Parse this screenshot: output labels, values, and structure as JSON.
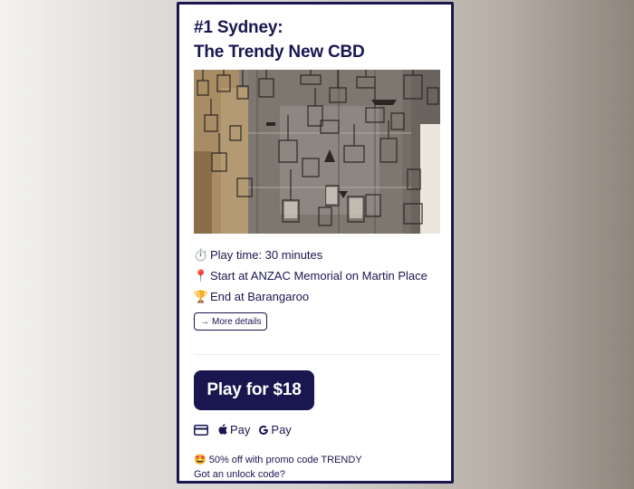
{
  "tour": {
    "title_line1": "#1 Sydney:",
    "title_line2": "The Trendy New CBD",
    "photo_icon": "hanging-birdcages-image"
  },
  "details": [
    {
      "icon": "stopwatch-icon",
      "emoji": "⏱️",
      "text": "Play time: 30 minutes"
    },
    {
      "icon": "pin-icon",
      "emoji": "📍",
      "text": "Start at ANZAC Memorial on Martin Place"
    },
    {
      "icon": "trophy-icon",
      "emoji": "🏆",
      "text": "End at Barangaroo"
    }
  ],
  "more_details": {
    "arrow": "→",
    "label": "More details"
  },
  "play": {
    "label": "Play for $18"
  },
  "payments": {
    "apple_pay": "Pay",
    "google_pay": "Pay"
  },
  "promo": {
    "emoji": "🤩",
    "text": "50% off with promo code TRENDY",
    "unlock": "Got an unlock code?"
  },
  "colors": {
    "navy": "#1a1650",
    "white": "#ffffff"
  }
}
